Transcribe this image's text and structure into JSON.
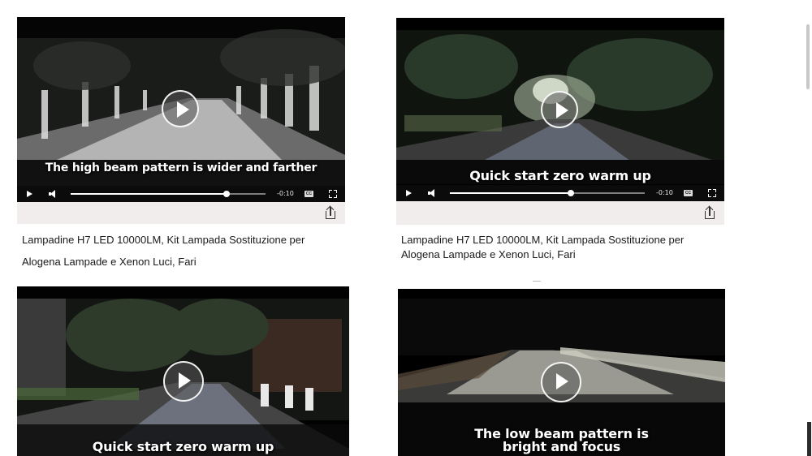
{
  "products": [
    {
      "video_caption_line1": "The high beam pattern is wider and farther",
      "video_caption_line2": "",
      "time_remaining": "-0:10",
      "cc_label": "CC",
      "progress": 0.8,
      "title_line1": "Lampadine H7 LED 10000LM, Kit Lampada Sostituzione per",
      "title_line2": "Alogena Lampade e Xenon Luci, Fari"
    },
    {
      "video_caption_line1": "Quick start zero warm up",
      "video_caption_line2": "",
      "time_remaining": "-0:10",
      "cc_label": "CC",
      "progress": 0.62,
      "title_line1": "Lampadine H7 LED 10000LM, Kit Lampada Sostituzione per",
      "title_line2": "Alogena Lampade e Xenon Luci, Fari"
    },
    {
      "video_caption_line1": "Quick start zero warm up",
      "video_caption_line2": ""
    },
    {
      "video_caption_line1": "The low beam pattern is",
      "video_caption_line2": "bright and focus"
    }
  ],
  "icons": {
    "play": "play-icon",
    "volume": "volume-icon",
    "captions": "closed-captions-icon",
    "fullscreen": "fullscreen-icon",
    "share": "share-icon"
  }
}
